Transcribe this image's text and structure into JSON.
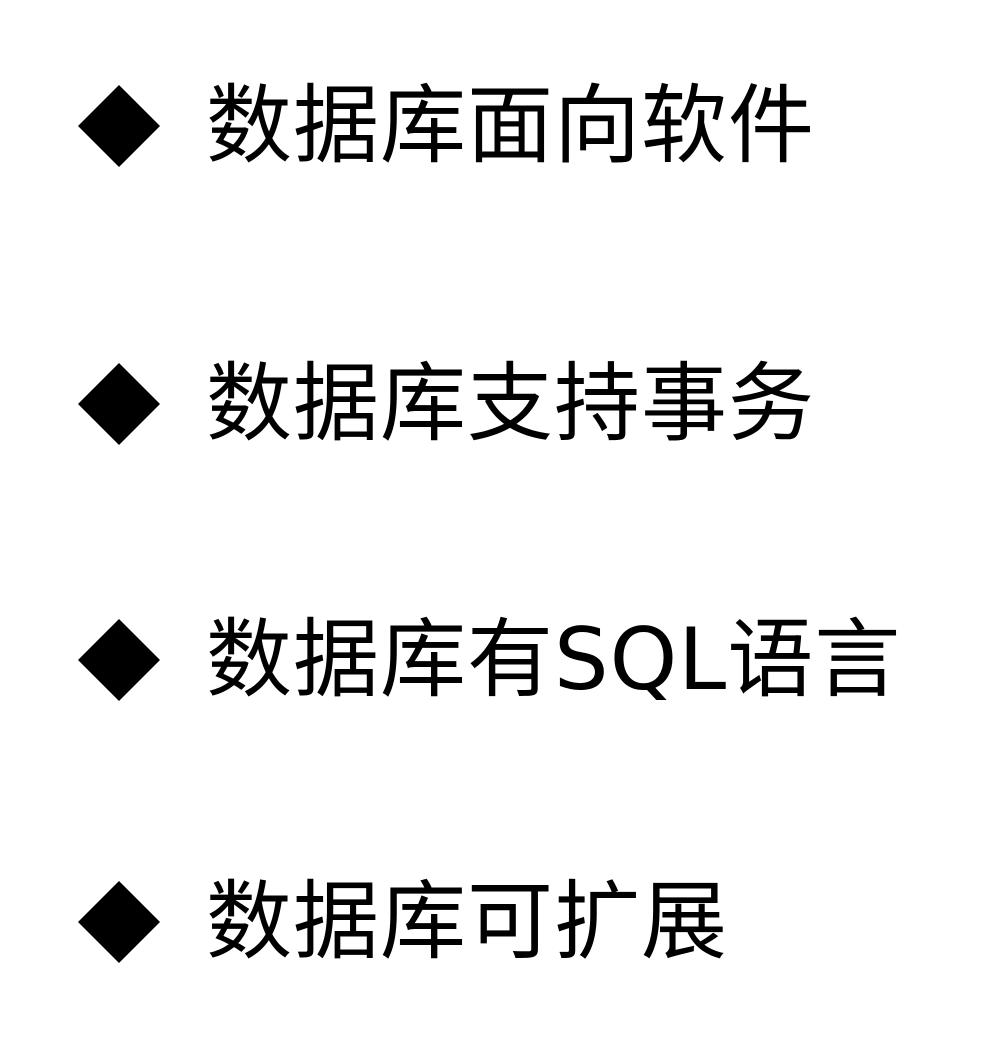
{
  "bullets": [
    {
      "text": "数据库面向软件",
      "icon": "diamond-bullet-icon"
    },
    {
      "text": "数据库支持事务",
      "icon": "diamond-bullet-icon"
    },
    {
      "text": "数据库有SQL语言",
      "icon": "diamond-bullet-icon"
    },
    {
      "text": "数据库可扩展",
      "icon": "diamond-bullet-icon"
    }
  ]
}
